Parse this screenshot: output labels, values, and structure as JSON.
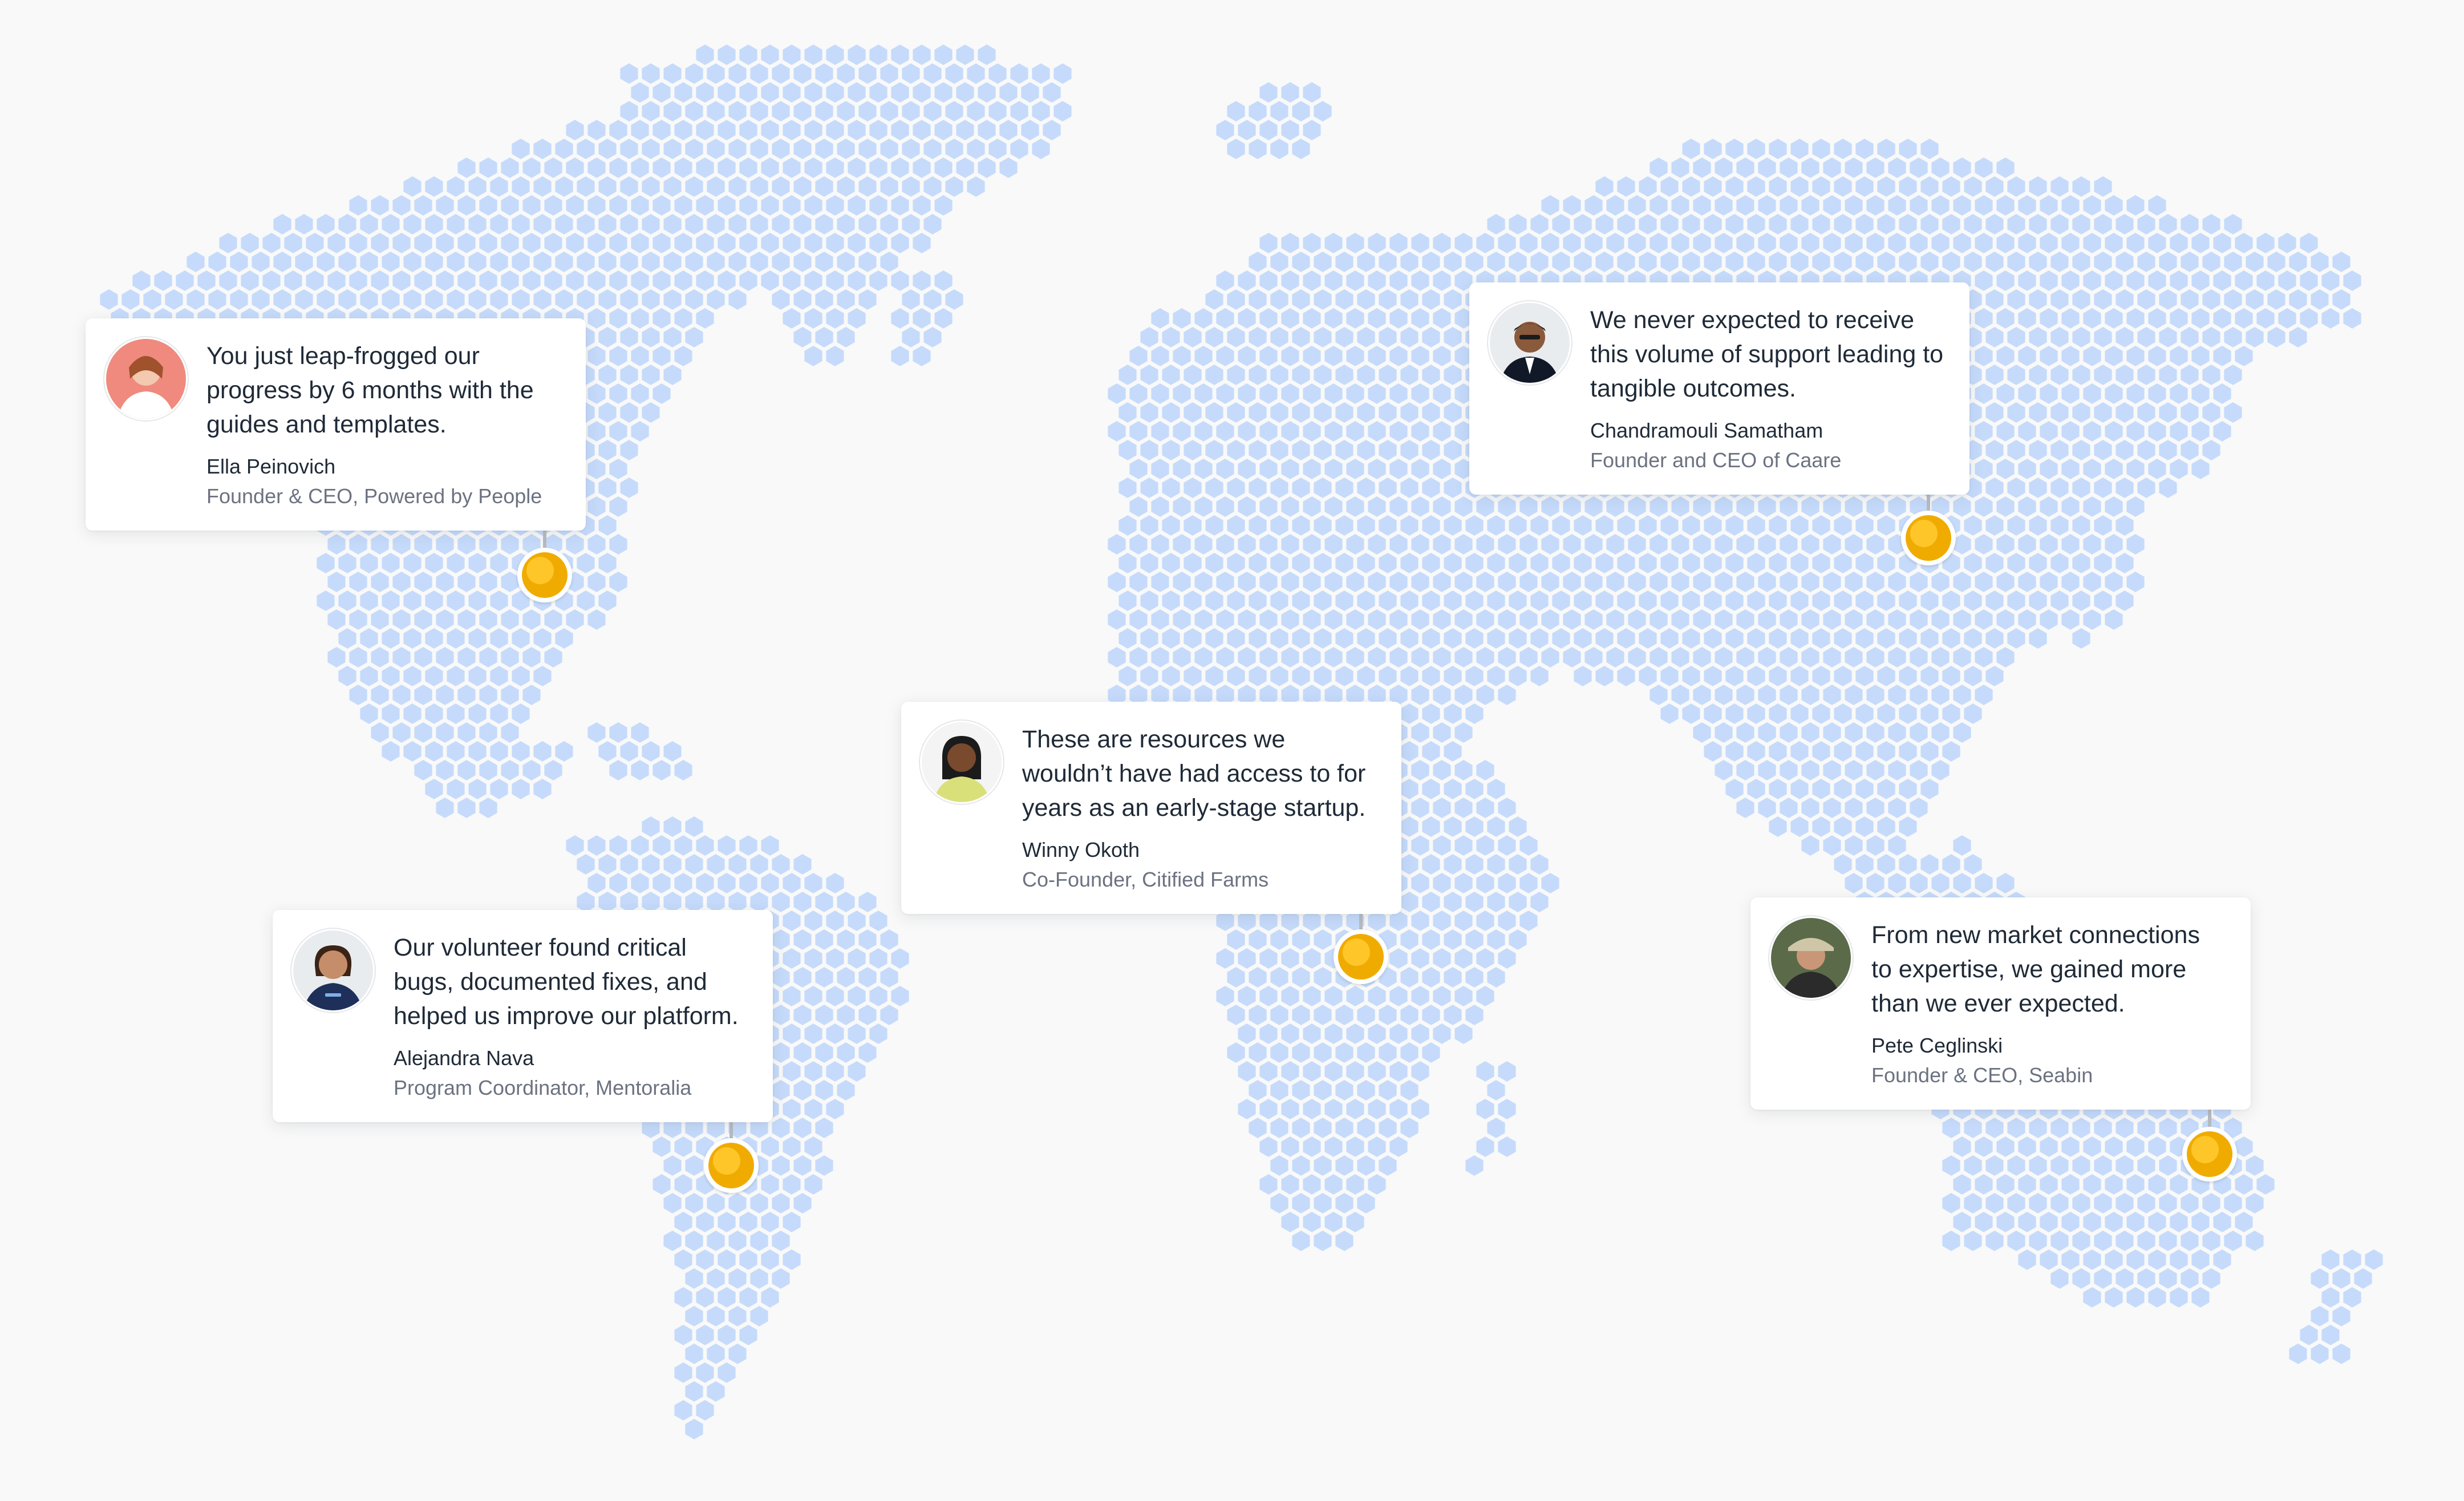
{
  "colors": {
    "background": "#f9f9f9",
    "hex_land": "#c6dbfb",
    "pin_outer": "#f0ab00",
    "pin_inner": "#ffc629",
    "text_primary": "#1f2a37",
    "text_secondary": "#6b7280"
  },
  "testimonials": [
    {
      "quote": "You just leap-frogged our progress by 6 months with the guides and templates.",
      "name": "Ella Peinovich",
      "role": "Founder & CEO, Powered by People",
      "avatar_icon": "person-avatar-icon"
    },
    {
      "quote": "We never expected to receive this volume of support leading to tangible outcomes.",
      "name": "Chandramouli Samatham",
      "role": "Founder and CEO of Caare",
      "avatar_icon": "person-avatar-icon"
    },
    {
      "quote": "These are resources we wouldn’t have had access to for years as an early-stage startup.",
      "name": "Winny Okoth",
      "role": "Co-Founder, Citified Farms",
      "avatar_icon": "person-avatar-icon"
    },
    {
      "quote": "Our volunteer found critical bugs, documented fixes, and helped us improve our platform.",
      "name": "Alejandra Nava",
      "role": "Program Coordinator, Mentoralia",
      "avatar_icon": "person-avatar-icon"
    },
    {
      "quote": "From new market connections to expertise, we gained more than we ever expected.",
      "name": "Pete Ceglinski",
      "role": "Founder & CEO, Seabin",
      "avatar_icon": "person-avatar-icon"
    }
  ]
}
